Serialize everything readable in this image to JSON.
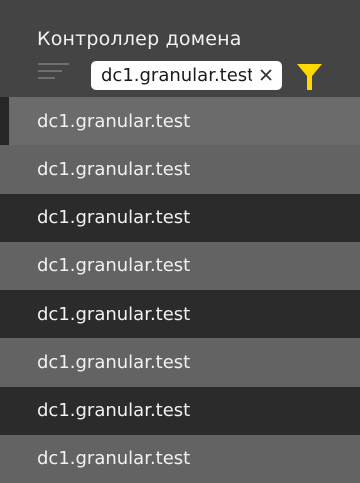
{
  "panel": {
    "title": "Контроллер домена"
  },
  "filter": {
    "value": "dc1.granular.test",
    "clear_icon": "close-icon",
    "filter_icon": "funnel-icon",
    "filter_icon_color": "#ffd800"
  },
  "menu_icon": "menu-lines-icon",
  "list": {
    "selected_index": 0,
    "items": [
      {
        "label": "dc1.granular.test"
      },
      {
        "label": "dc1.granular.test"
      },
      {
        "label": "dc1.granular.test"
      },
      {
        "label": "dc1.granular.test"
      },
      {
        "label": "dc1.granular.test"
      },
      {
        "label": "dc1.granular.test"
      },
      {
        "label": "dc1.granular.test"
      },
      {
        "label": "dc1.granular.test"
      }
    ]
  }
}
